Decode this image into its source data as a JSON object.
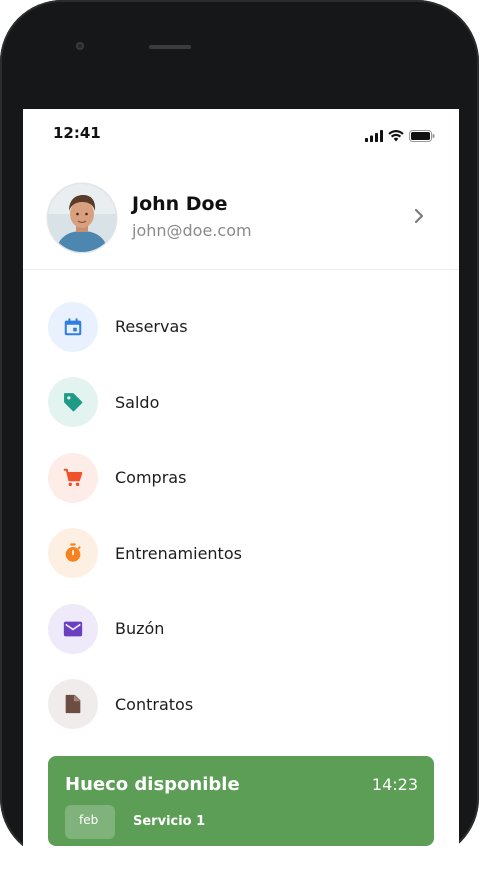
{
  "status": {
    "time": "12:41"
  },
  "profile": {
    "name": "John Doe",
    "email": "john@doe.com"
  },
  "menu": {
    "items": [
      {
        "label": "Reservas",
        "icon": "calendar-icon",
        "color": "#2f7de1",
        "bg": "#e8f1fd"
      },
      {
        "label": "Saldo",
        "icon": "tag-icon",
        "color": "#1e9b86",
        "bg": "#e3f4f0"
      },
      {
        "label": "Compras",
        "icon": "cart-icon",
        "color": "#f0512b",
        "bg": "#fdece7"
      },
      {
        "label": "Entrenamientos",
        "icon": "stopwatch-icon",
        "color": "#f5821f",
        "bg": "#fdf0e3"
      },
      {
        "label": "Buzón",
        "icon": "mail-icon",
        "color": "#6a3fc0",
        "bg": "#efeaf9"
      },
      {
        "label": "Contratos",
        "icon": "document-icon",
        "color": "#6d4c41",
        "bg": "#efeceb"
      }
    ]
  },
  "toast": {
    "title": "Hueco disponible",
    "time": "14:23",
    "chip": "feb",
    "subtitle": "Servicio 1",
    "color": "#5d9e57"
  }
}
